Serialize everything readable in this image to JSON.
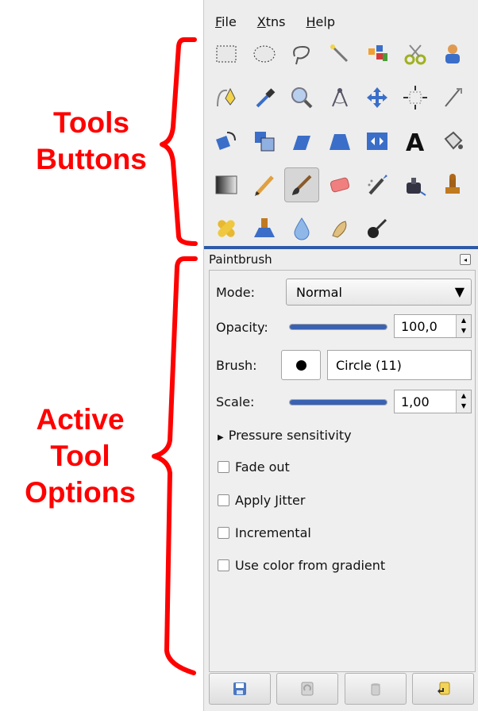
{
  "annotations": {
    "tools_line1": "Tools",
    "tools_line2": "Buttons",
    "options_line1": "Active",
    "options_line2": "Tool",
    "options_line3": "Options"
  },
  "menubar": [
    {
      "mnemonic": "F",
      "rest": "ile"
    },
    {
      "mnemonic": "X",
      "rest": "tns"
    },
    {
      "mnemonic": "H",
      "rest": "elp"
    }
  ],
  "toolbox": {
    "active_tool": "paintbrush-tool",
    "tools": [
      "rect-select-tool-icon",
      "ellipse-select-tool-icon",
      "free-select-tool-icon",
      "fuzzy-select-tool-icon",
      "select-by-color-tool-icon",
      "scissors-tool-icon",
      "foreground-select-tool-icon",
      "paths-tool-icon",
      "color-picker-tool-icon",
      "zoom-tool-icon",
      "measure-tool-icon",
      "move-tool-icon",
      "align-tool-icon",
      "crop-tool-icon",
      "rotate-tool-icon",
      "scale-tool-icon",
      "shear-tool-icon",
      "perspective-tool-icon",
      "flip-tool-icon",
      "text-tool-icon",
      "bucket-fill-tool-icon",
      "blend-tool-icon",
      "pencil-tool-icon",
      "paintbrush-tool-icon",
      "eraser-tool-icon",
      "airbrush-tool-icon",
      "ink-tool-icon",
      "clone-tool-icon",
      "heal-tool-icon",
      "perspective-clone-tool-icon",
      "blur-sharpen-tool-icon",
      "smudge-tool-icon",
      "dodge-burn-tool-icon"
    ]
  },
  "tool_options": {
    "title": "Paintbrush",
    "mode_label": "Mode:",
    "mode_value": "Normal",
    "opacity_label": "Opacity:",
    "opacity_value": "100,0",
    "opacity_fraction": 1.0,
    "brush_label": "Brush:",
    "brush_name": "Circle (11)",
    "scale_label": "Scale:",
    "scale_value": "1,00",
    "scale_fraction": 1.0,
    "pressure_label": "Pressure sensitivity",
    "checkboxes": [
      {
        "label": "Fade out",
        "checked": false
      },
      {
        "label": "Apply Jitter",
        "checked": false
      },
      {
        "label": "Incremental",
        "checked": false
      },
      {
        "label": "Use color from gradient",
        "checked": false
      }
    ]
  },
  "bottom_buttons": [
    "save-icon",
    "restore-icon",
    "delete-icon",
    "reset-icon"
  ],
  "colors": {
    "accent": "#2e5aa7",
    "annotation": "#ff0000"
  }
}
